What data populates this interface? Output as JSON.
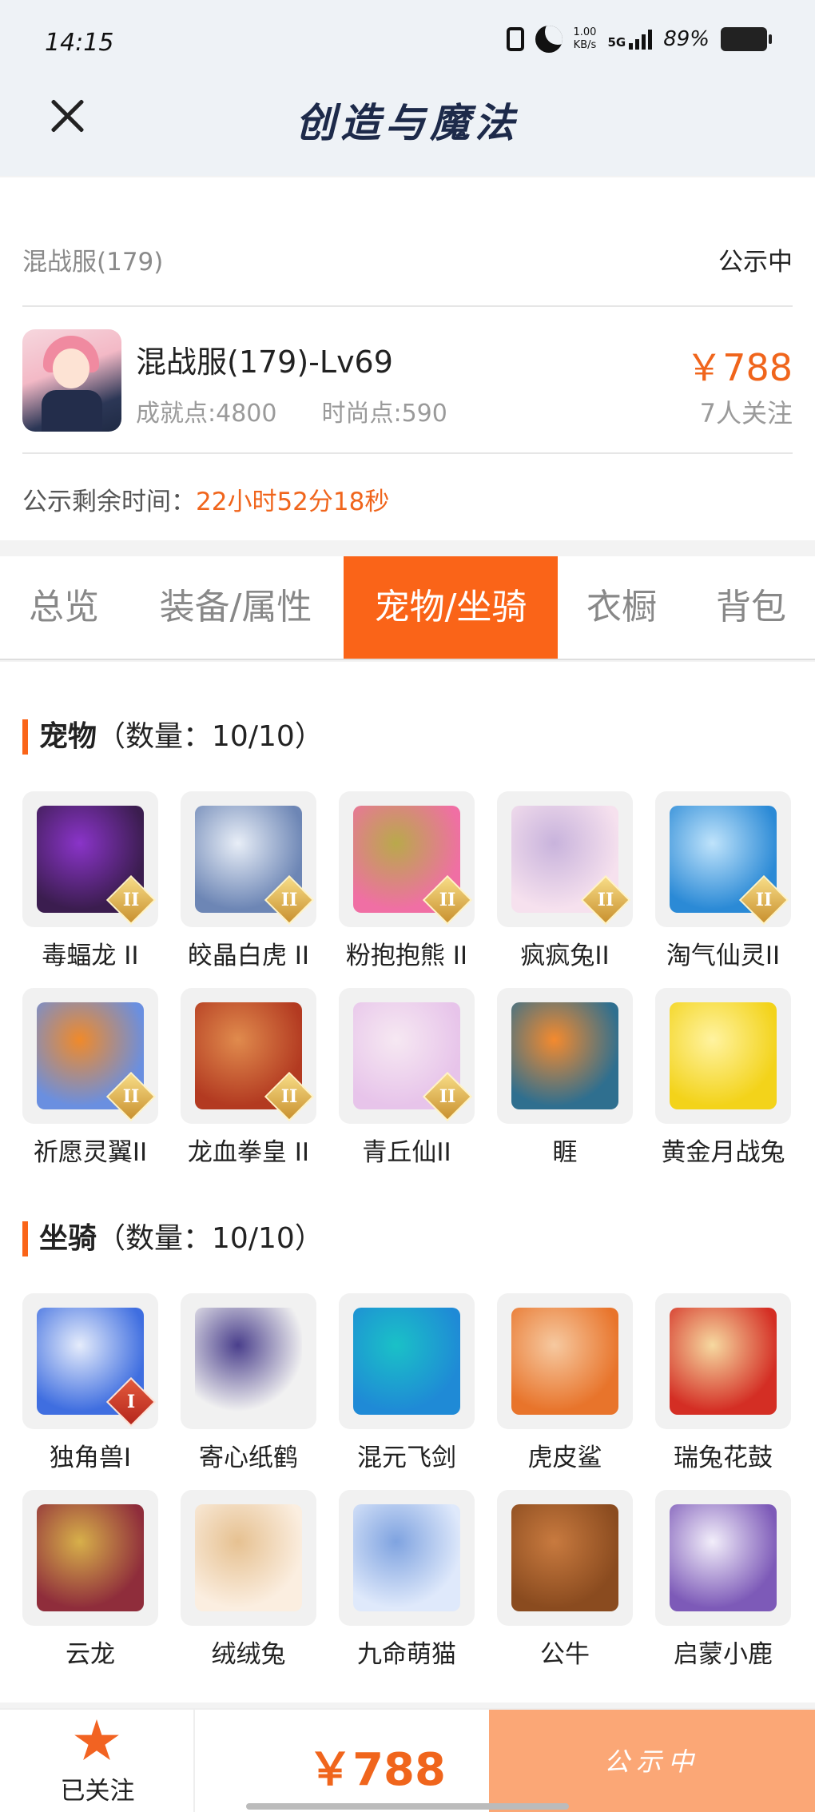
{
  "status_bar": {
    "time": "14:15",
    "net_speed": "1.00",
    "net_unit": "KB/s",
    "signal": "5G",
    "battery": "89%"
  },
  "nav": {
    "title": "创造与魔法"
  },
  "listing": {
    "server": "混战服(179)",
    "status": "公示中",
    "character": "混战服(179)-Lv69",
    "achievement": "成就点:4800",
    "fashion": "时尚点:590",
    "price": "￥788",
    "followers": "7人关注",
    "remaining_label": "公示剩余时间：",
    "remaining_value": "22小时52分18秒"
  },
  "tabs": [
    {
      "label": "总览"
    },
    {
      "label": "装备/属性"
    },
    {
      "label": "宠物/坐骑",
      "active": true
    },
    {
      "label": "衣橱"
    },
    {
      "label": "背包"
    }
  ],
  "pets": {
    "title": "宠物",
    "count": "（数量：10/10）",
    "items": [
      {
        "name": "毒蝠龙 II",
        "icon": "purple-bat-dragon",
        "rank": "II"
      },
      {
        "name": "皎晶白虎 II",
        "icon": "white-crystal-tiger",
        "rank": "II"
      },
      {
        "name": "粉抱抱熊 II",
        "icon": "pink-hug-bear",
        "rank": "II"
      },
      {
        "name": "疯疯兔II",
        "icon": "crazy-rabbit",
        "rank": "II"
      },
      {
        "name": "淘气仙灵II",
        "icon": "naughty-fairy-dog",
        "rank": "II"
      },
      {
        "name": "祈愿灵翼II",
        "icon": "wish-spirit-eagle",
        "rank": "II"
      },
      {
        "name": "龙血拳皇 II",
        "icon": "dragon-blood-fist-ram",
        "rank": "II"
      },
      {
        "name": "青丘仙II",
        "icon": "qingqiu-fox-fairy",
        "rank": "II"
      },
      {
        "name": "睚",
        "icon": "yazi-dragon",
        "rank": ""
      },
      {
        "name": "黄金月战兔",
        "icon": "golden-moon-rabbit",
        "rank": ""
      }
    ]
  },
  "mounts": {
    "title": "坐骑",
    "count": "（数量：10/10）",
    "items": [
      {
        "name": "独角兽I",
        "icon": "unicorn",
        "rank": "I"
      },
      {
        "name": "寄心纸鹤",
        "icon": "paper-crane",
        "rank": ""
      },
      {
        "name": "混元飞剑",
        "icon": "flying-sword",
        "rank": ""
      },
      {
        "name": "虎皮鲨",
        "icon": "tiger-shark",
        "rank": ""
      },
      {
        "name": "瑞兔花鼓",
        "icon": "rabbit-drum",
        "rank": ""
      },
      {
        "name": "云龙",
        "icon": "cloud-dragon",
        "rank": ""
      },
      {
        "name": "绒绒兔",
        "icon": "fluffy-rabbit",
        "rank": ""
      },
      {
        "name": "九命萌猫",
        "icon": "nine-lives-cat",
        "rank": ""
      },
      {
        "name": "公牛",
        "icon": "bull",
        "rank": ""
      },
      {
        "name": "启蒙小鹿",
        "icon": "enlightenment-deer",
        "rank": ""
      }
    ]
  },
  "bottom": {
    "follow_label": "已关注",
    "price": "￥788",
    "action": "公示中"
  },
  "colors": {
    "accent": "#fa6418",
    "price": "#f0651c",
    "action_bg": "#fba776"
  }
}
